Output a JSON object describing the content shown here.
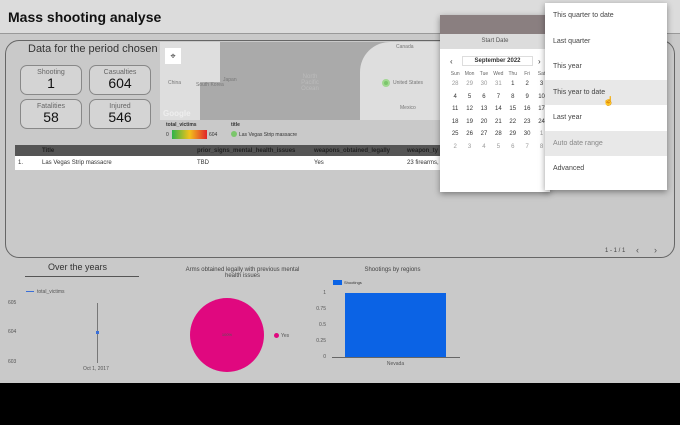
{
  "header": {
    "title": "Mass shooting analyse"
  },
  "panel": {
    "title": "Data for the period chosen",
    "cards": [
      {
        "label": "Shooting",
        "value": "1"
      },
      {
        "label": "Casualties",
        "value": "604"
      },
      {
        "label": "Fatalities",
        "value": "58"
      },
      {
        "label": "Injured",
        "value": "546"
      }
    ]
  },
  "map": {
    "labels": [
      "China",
      "South Korea",
      "Japan",
      "North Pacific Ocean",
      "Canada",
      "United States",
      "Mexico"
    ],
    "brand": "Google",
    "legend": {
      "color_title": "total_victims",
      "min": "0",
      "max": "604",
      "series_title": "title",
      "series_item": "Las Vegas Strip massacre"
    }
  },
  "table": {
    "headers": [
      "Title",
      "prior_signs_mental_health_issues",
      "weapons_obtained_legally",
      "weapon_ty"
    ],
    "rows": [
      {
        "index": "1.",
        "cells": [
          "Las Vegas Strip massacre",
          "TBD",
          "Yes",
          "23 firearms,"
        ]
      }
    ],
    "pagination": "1 - 1 / 1"
  },
  "calendar": {
    "label": "Start Date",
    "month": "September 2022",
    "weekdays": [
      "Sun",
      "Mon",
      "Tue",
      "Wed",
      "Thu",
      "Fri",
      "Sat"
    ],
    "days": [
      "28",
      "29",
      "30",
      "31",
      "1",
      "2",
      "3",
      "4",
      "5",
      "6",
      "7",
      "8",
      "9",
      "10",
      "11",
      "12",
      "13",
      "14",
      "15",
      "16",
      "17",
      "18",
      "19",
      "20",
      "21",
      "22",
      "23",
      "24",
      "25",
      "26",
      "27",
      "28",
      "29",
      "30",
      "1",
      "2",
      "3",
      "4",
      "5",
      "6",
      "7",
      "8"
    ]
  },
  "menu": {
    "items": [
      "This quarter to date",
      "Last quarter",
      "This year",
      "This year to date",
      "Last year",
      "Auto date range",
      "Advanced"
    ],
    "hovered": "This year to date"
  },
  "over_years": {
    "title": "Over the years",
    "chart_data": {
      "type": "line",
      "series": [
        {
          "name": "total_victims",
          "x": [
            "Oct 1, 2017"
          ],
          "values": [
            604
          ]
        }
      ],
      "yticks": [
        "605",
        "604",
        "603"
      ],
      "ylim": [
        603,
        605
      ],
      "xticks": [
        "Oct 1, 2017"
      ]
    }
  },
  "pie": {
    "title": "Arms obtained legally with previous mental health issues",
    "chart_data": {
      "type": "pie",
      "slices": [
        {
          "label": "Yes",
          "value": 100,
          "display": "100%",
          "color": "#e0087f"
        }
      ]
    }
  },
  "bar": {
    "title": "Shootings by regions",
    "chart_data": {
      "type": "bar",
      "categories": [
        "Nevada"
      ],
      "series": [
        {
          "name": "Shootings",
          "values": [
            1
          ]
        }
      ],
      "yticks": [
        "1",
        "0.75",
        "0.5",
        "0.25",
        "0"
      ],
      "ylim": [
        0,
        1
      ],
      "color": "#0b63e5"
    }
  }
}
